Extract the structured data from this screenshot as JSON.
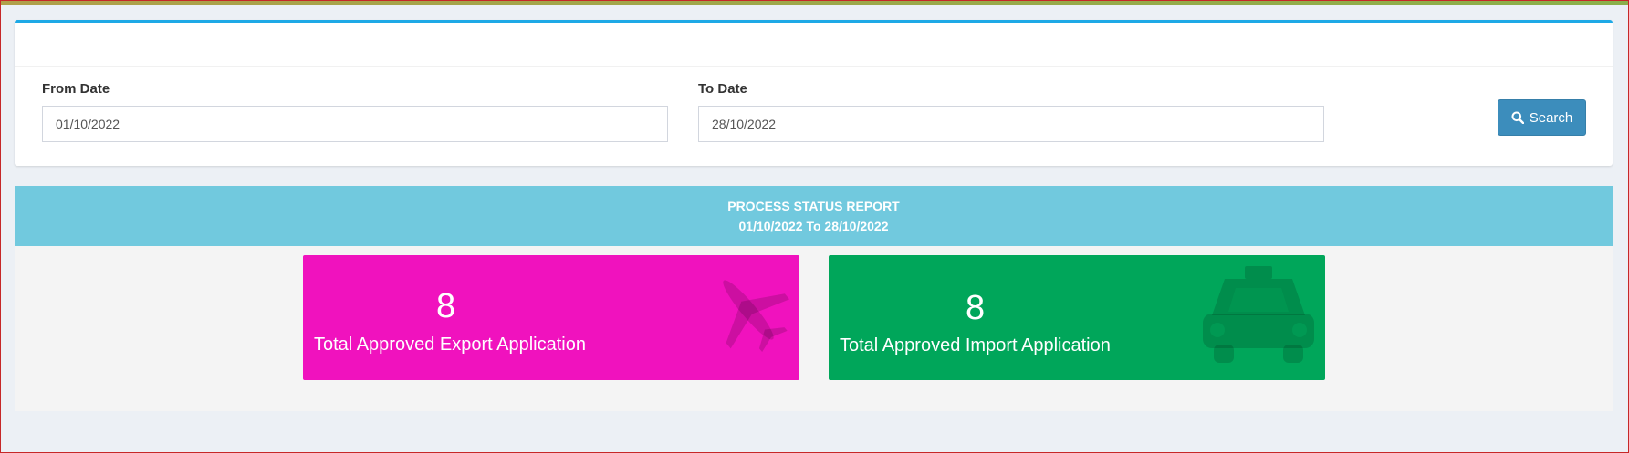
{
  "filter": {
    "from_label": "From Date",
    "from_value": "01/10/2022",
    "to_label": "To Date",
    "to_value": "28/10/2022",
    "search_label": "Search"
  },
  "report": {
    "title": "PROCESS STATUS REPORT",
    "range": "01/10/2022 To 28/10/2022"
  },
  "cards": [
    {
      "count": "8",
      "caption": "Total Approved Export Application",
      "icon": "plane-icon",
      "color": "#f012be"
    },
    {
      "count": "8",
      "caption": "Total Approved Import Application",
      "icon": "taxi-icon",
      "color": "#00a65a"
    }
  ],
  "colors": {
    "accent": "#1ea9e6",
    "button": "#3c8dbc",
    "band": "#71c9de"
  }
}
